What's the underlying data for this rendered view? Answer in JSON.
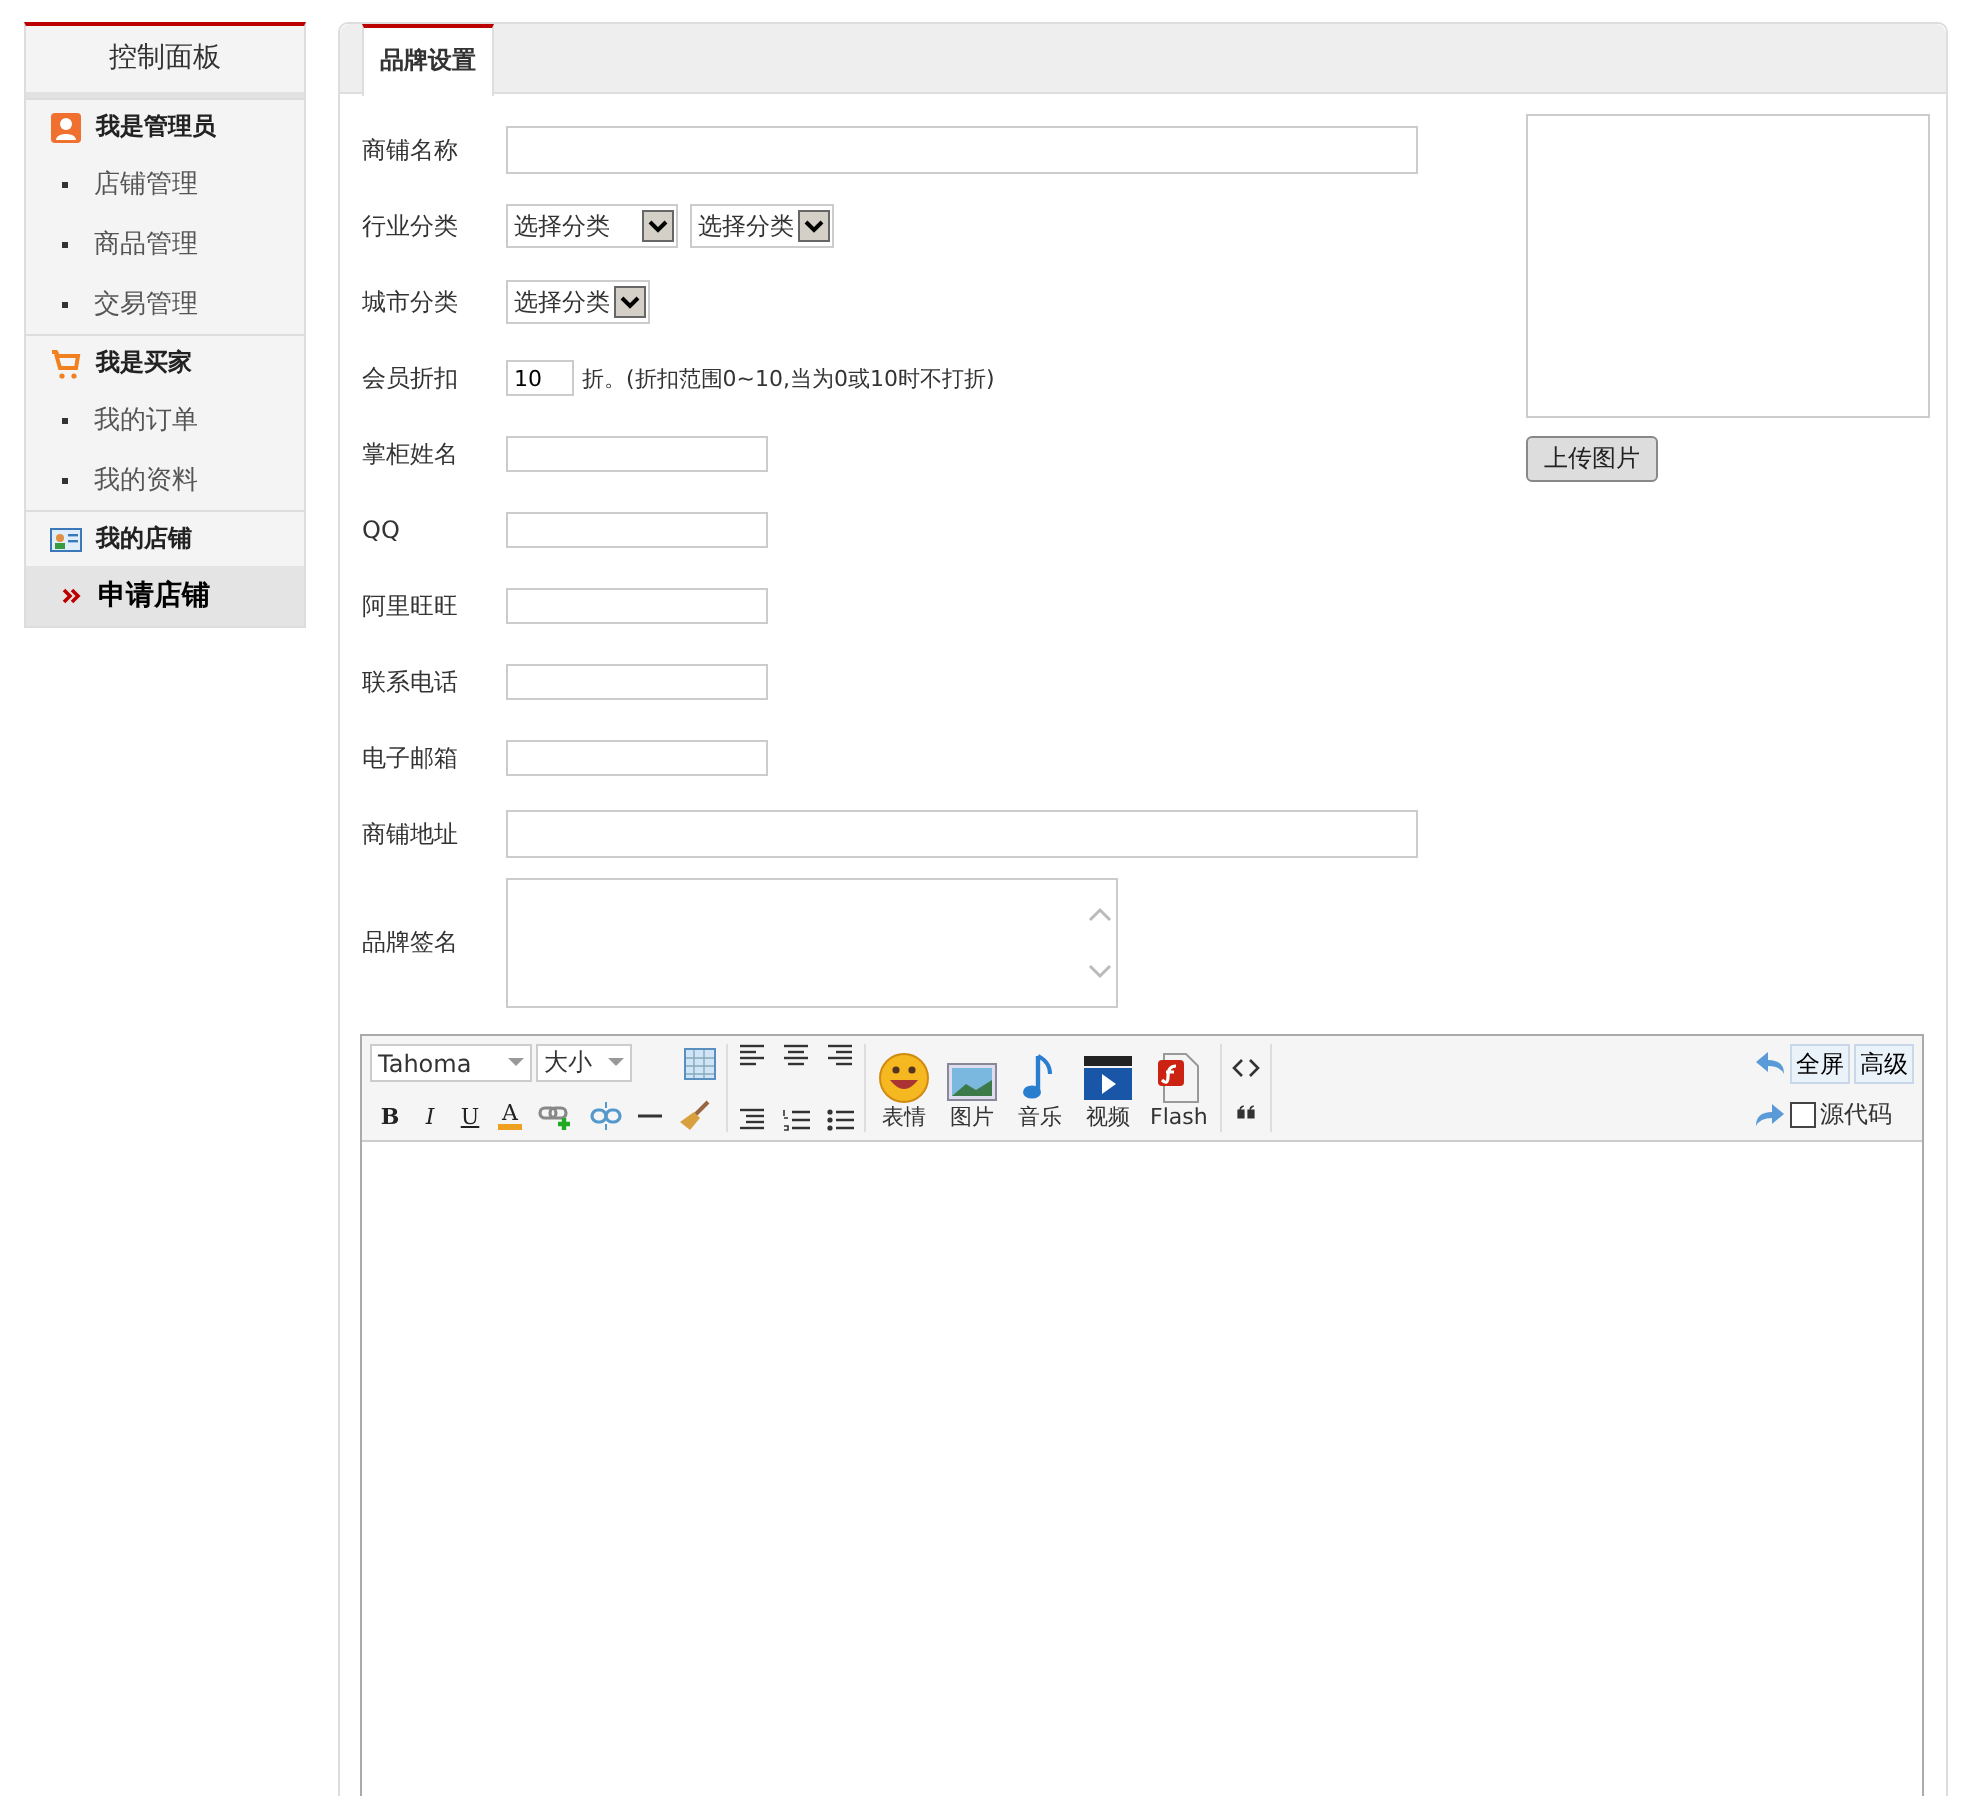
{
  "sidebar": {
    "title": "控制面板",
    "groups": [
      {
        "label": "我是管理员",
        "kind": "person",
        "items": [
          {
            "label": "店铺管理",
            "selected": false
          },
          {
            "label": "商品管理",
            "selected": false
          },
          {
            "label": "交易管理",
            "selected": false
          }
        ]
      },
      {
        "label": "我是买家",
        "kind": "cart",
        "items": [
          {
            "label": "我的订单",
            "selected": false
          },
          {
            "label": "我的资料",
            "selected": false
          }
        ]
      },
      {
        "label": "我的店铺",
        "kind": "card",
        "items": [
          {
            "label": "申请店铺",
            "selected": true
          }
        ]
      }
    ]
  },
  "tabs": [
    {
      "label": "品牌设置",
      "selected": true
    }
  ],
  "form": {
    "rows": [
      {
        "label": "商铺名称",
        "kind": "wide"
      },
      {
        "label": "行业分类",
        "kind": "select",
        "selects": [
          "选择分类",
          "选择分类"
        ]
      },
      {
        "label": "城市分类",
        "kind": "select",
        "selects": [
          "选择分类"
        ]
      },
      {
        "label": "会员折扣",
        "kind": "discount",
        "value": "10",
        "hint": "折。(折扣范围0~10,当为0或10时不打折)"
      },
      {
        "label": "掌柜姓名",
        "kind": "short"
      },
      {
        "label": "QQ",
        "kind": "short"
      },
      {
        "label": "阿里旺旺",
        "kind": "short"
      },
      {
        "label": "联系电话",
        "kind": "short"
      },
      {
        "label": "电子邮箱",
        "kind": "short"
      },
      {
        "label": "商铺地址",
        "kind": "wide"
      },
      {
        "label": "品牌签名",
        "kind": "textarea"
      }
    ],
    "upload_button": "上传图片"
  },
  "editor": {
    "font": "Tahoma",
    "size": "大小",
    "format_buttons": [
      {
        "label": "B",
        "kind": "bold"
      },
      {
        "label": "I",
        "kind": "italic"
      },
      {
        "label": "U",
        "kind": "underline"
      },
      {
        "label": "A",
        "kind": "color"
      }
    ],
    "media_buttons": [
      {
        "label": "表情",
        "kind": "emoji"
      },
      {
        "label": "图片",
        "kind": "image"
      },
      {
        "label": "音乐",
        "kind": "music"
      },
      {
        "label": "视频",
        "kind": "video"
      },
      {
        "label": "Flash",
        "kind": "flash"
      }
    ],
    "fullscreen": "全屏",
    "advanced": "高级",
    "source": {
      "label": "源代码",
      "checked": false
    }
  }
}
